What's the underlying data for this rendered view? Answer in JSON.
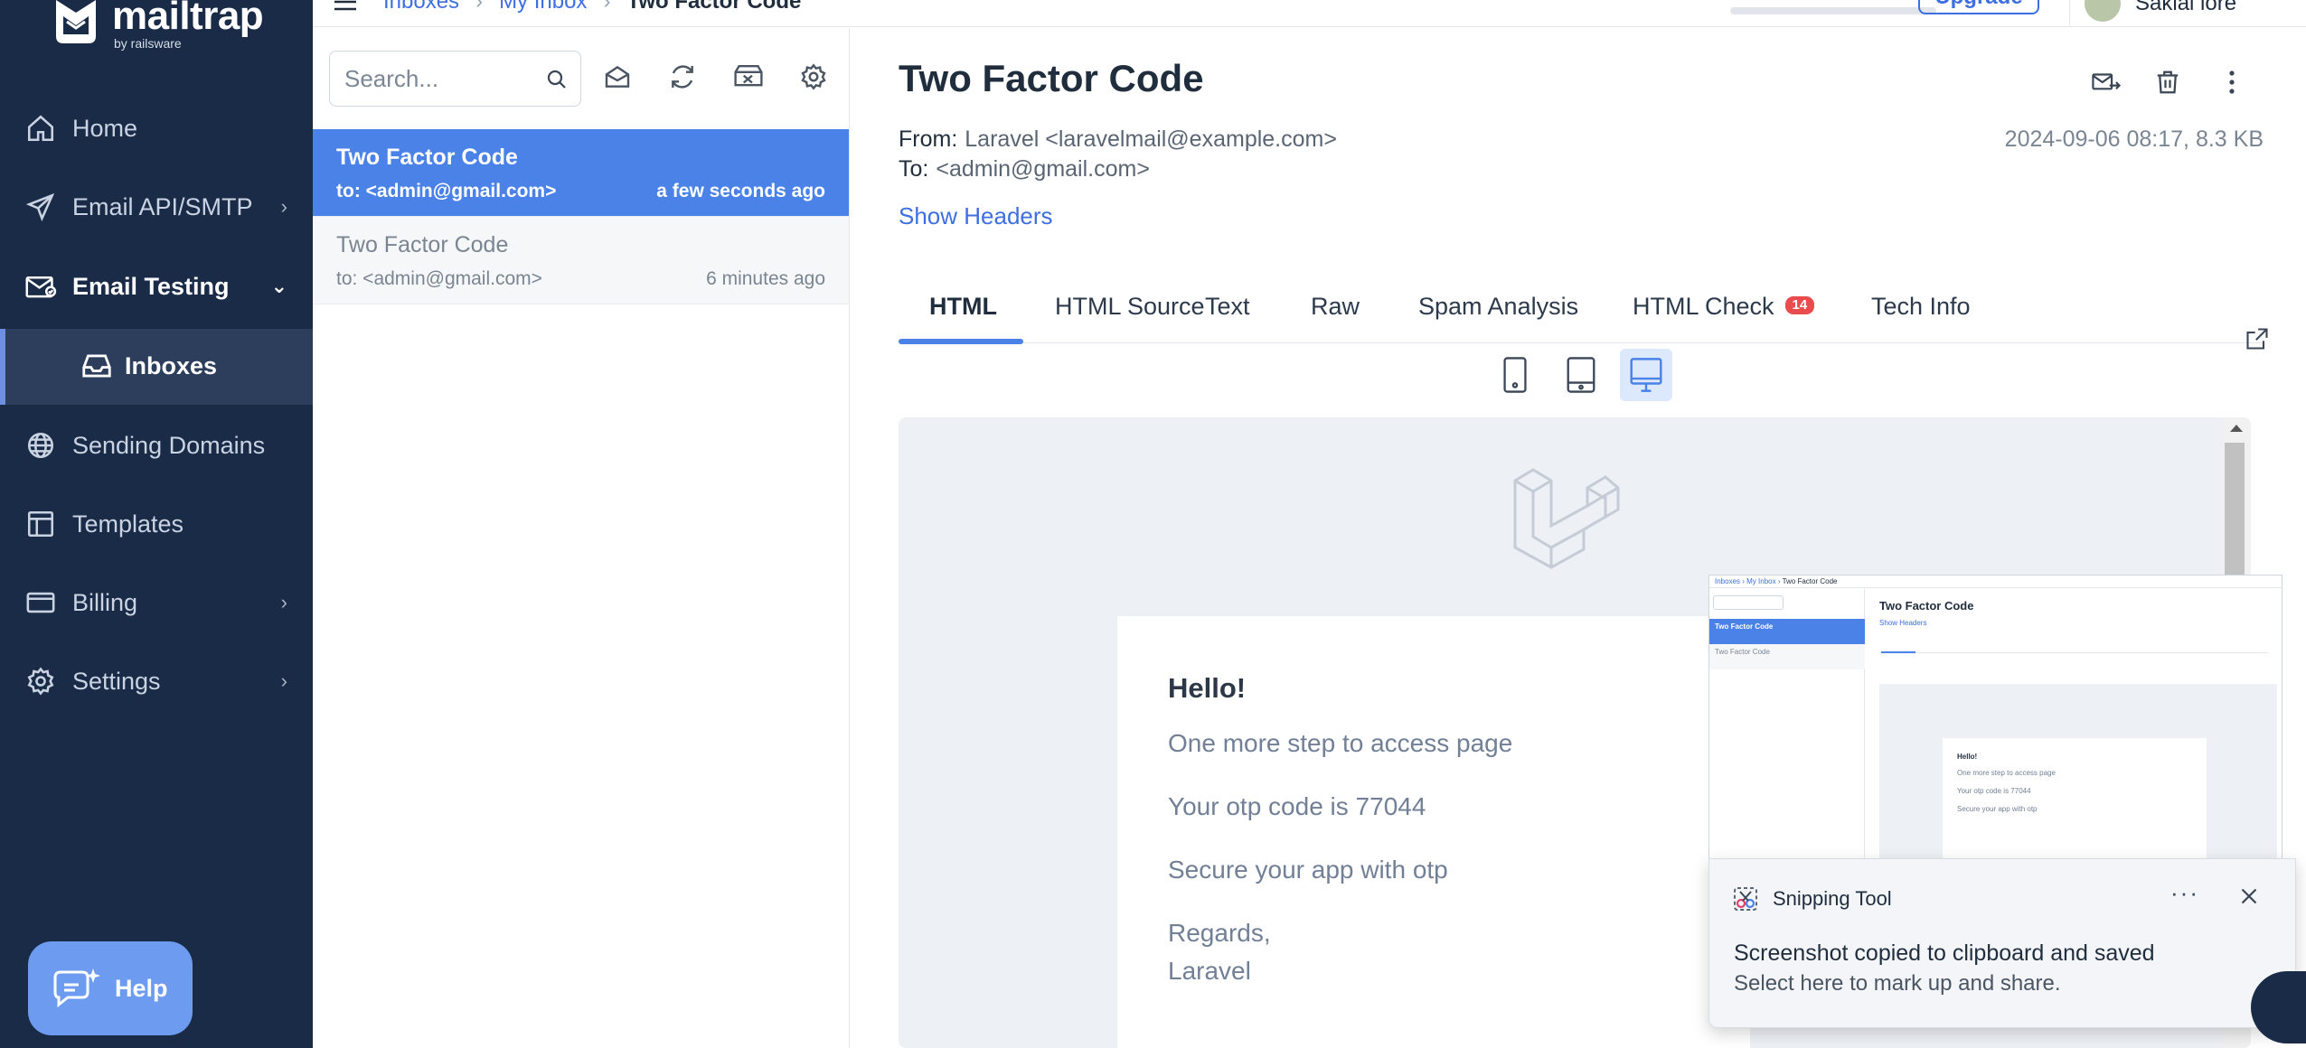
{
  "brand": {
    "name": "mailtrap",
    "sub": "by railsware"
  },
  "sidebar": {
    "items": [
      {
        "label": "Home",
        "icon": "home-icon"
      },
      {
        "label": "Email API/SMTP",
        "icon": "send-icon"
      },
      {
        "label": "Email Testing",
        "icon": "email-testing-icon"
      },
      {
        "label": "Inboxes",
        "icon": "inbox-icon"
      },
      {
        "label": "Sending Domains",
        "icon": "globe-icon"
      },
      {
        "label": "Templates",
        "icon": "templates-icon"
      },
      {
        "label": "Billing",
        "icon": "billing-icon"
      },
      {
        "label": "Settings",
        "icon": "gear-icon"
      }
    ],
    "help_label": "Help"
  },
  "topbar": {
    "crumbs": [
      "Inboxes",
      "My Inbox",
      "Two Factor Code"
    ],
    "upgrade_label": "Upgrade",
    "user_name": "Sakiai lore"
  },
  "list": {
    "search_placeholder": "Search...",
    "messages": [
      {
        "subject": "Two Factor Code",
        "to": "to: <admin@gmail.com>",
        "time": "a few seconds ago"
      },
      {
        "subject": "Two Factor Code",
        "to": "to: <admin@gmail.com>",
        "time": "6 minutes ago"
      }
    ]
  },
  "detail": {
    "title": "Two Factor Code",
    "from_label": "From:",
    "from_value": "Laravel <laravelmail@example.com>",
    "to_label": "To:",
    "to_value": "<admin@gmail.com>",
    "date_size": "2024-09-06 08:17, 8.3 KB",
    "show_headers": "Show Headers",
    "tabs": [
      "HTML",
      "HTML Source",
      "Text",
      "Raw",
      "Spam Analysis",
      "HTML Check",
      "Tech Info"
    ],
    "html_check_badge": "14",
    "active_tab": "HTML",
    "active_device": "desktop"
  },
  "email_body": {
    "hello": "Hello!",
    "line1": "One more step to access page",
    "line2": "Your otp code is 77044",
    "line3": "Secure your app with otp",
    "line4": "Regards,",
    "line5": "Laravel"
  },
  "toast": {
    "app_name": "Snipping Tool",
    "title": "Screenshot copied to clipboard and saved",
    "subtitle": "Select here to mark up and share.",
    "more": "···"
  },
  "colors": {
    "sidebar": "#1a2b47",
    "accent": "#4a82e8",
    "badge": "#e94c4c"
  }
}
